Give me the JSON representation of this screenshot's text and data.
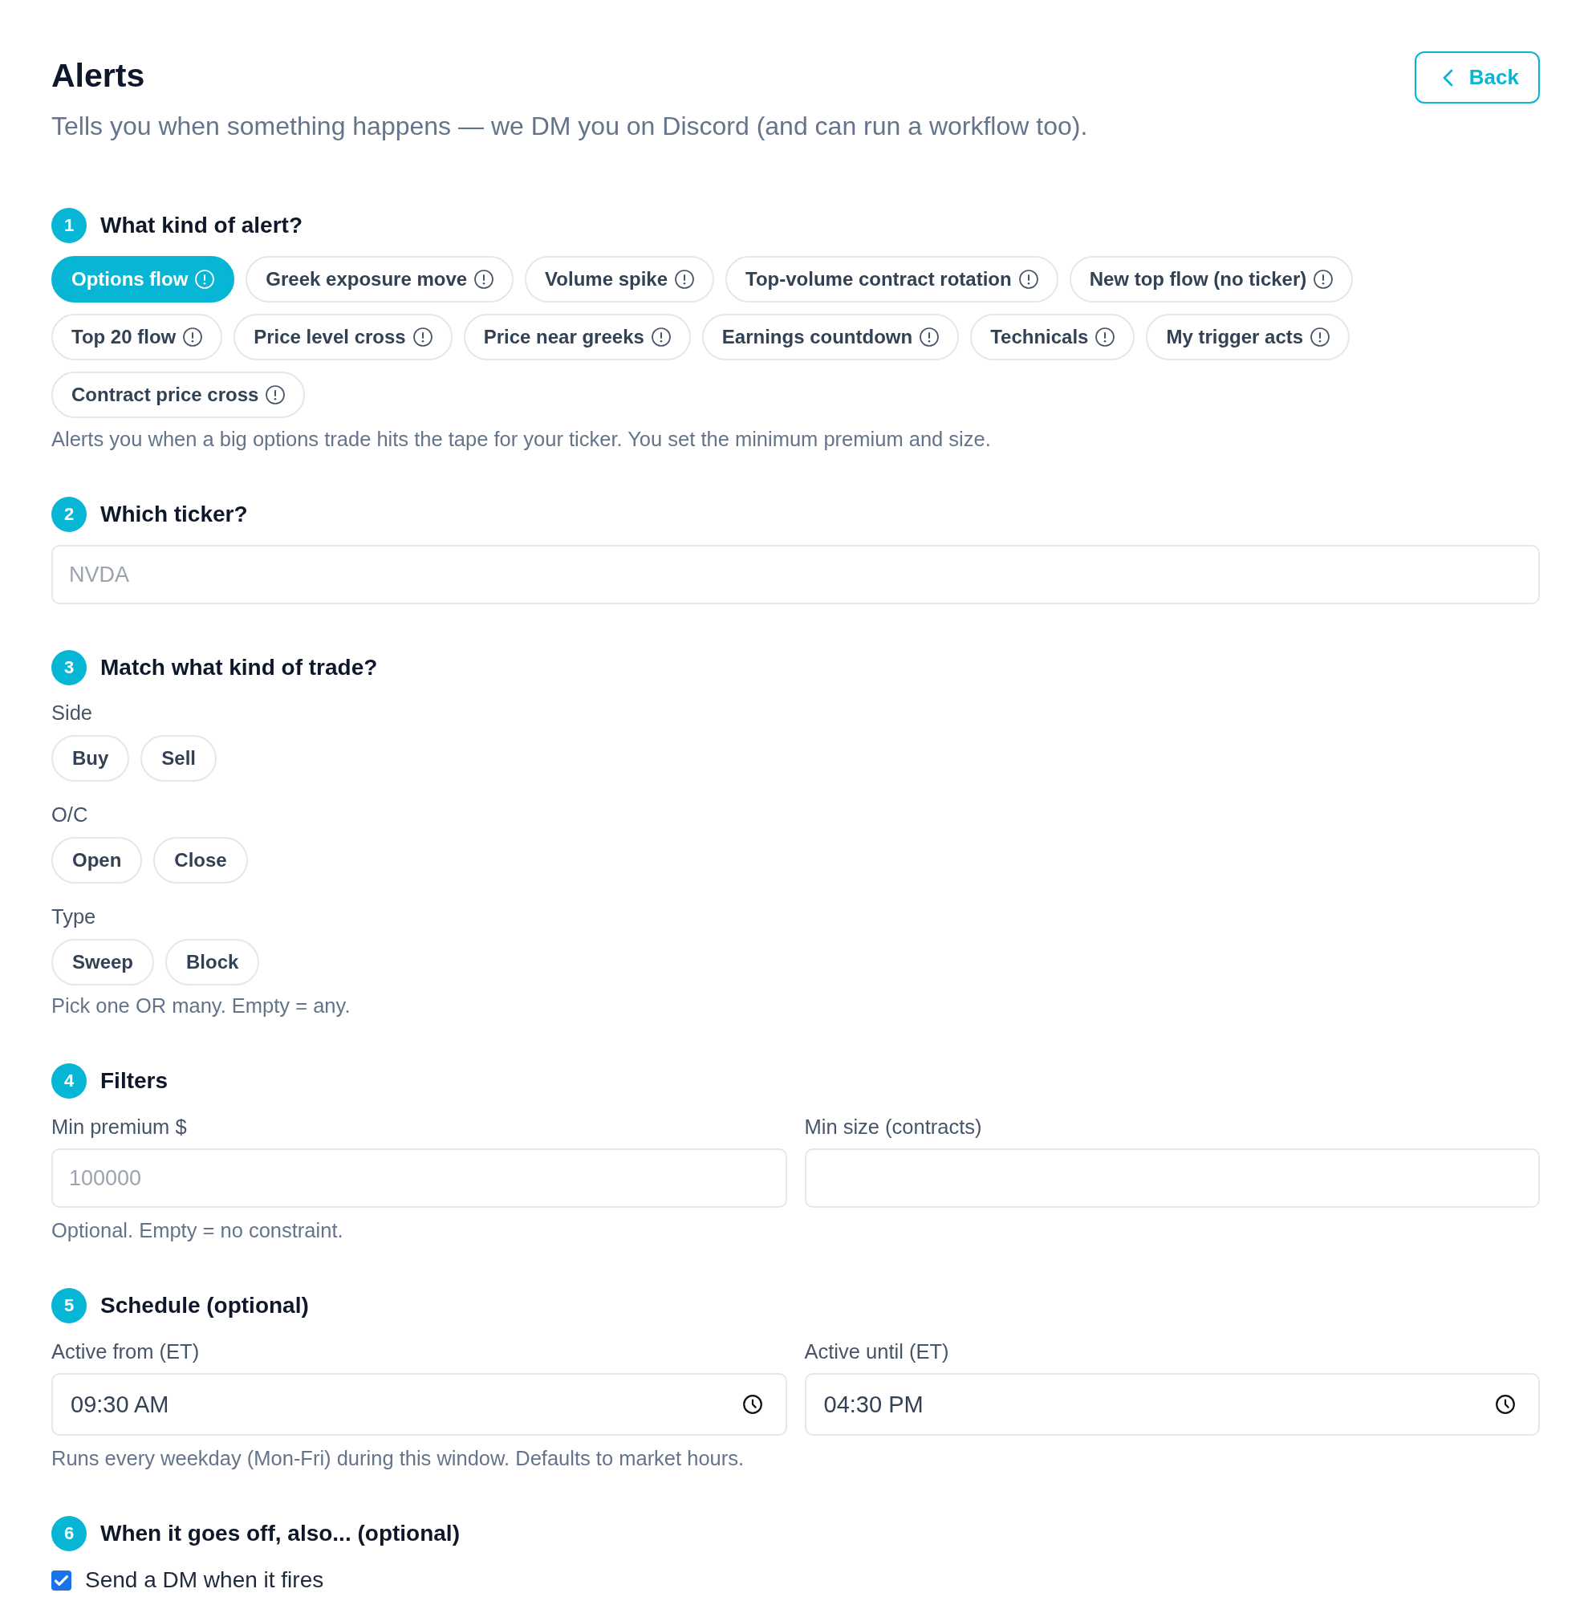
{
  "header": {
    "title": "Alerts",
    "subtitle": "Tells you when something happens — we DM you on Discord (and can run a workflow too).",
    "back_button": {
      "label": "Back"
    }
  },
  "sections": [
    {
      "kind": "chips",
      "number": "1",
      "title": "What kind of alert?",
      "options": [
        {
          "label": "Options flow",
          "selected": true
        },
        {
          "label": "Greek exposure move",
          "selected": false
        },
        {
          "label": "Volume spike",
          "selected": false
        },
        {
          "label": "Top-volume contract rotation",
          "selected": false
        },
        {
          "label": "New top flow (no ticker)",
          "selected": false
        },
        {
          "label": "Top 20 flow",
          "selected": false
        },
        {
          "label": "Price level cross",
          "selected": false
        },
        {
          "label": "Price near greeks",
          "selected": false
        },
        {
          "label": "Earnings countdown",
          "selected": false
        },
        {
          "label": "Technicals",
          "selected": false
        },
        {
          "label": "My trigger acts",
          "selected": false
        },
        {
          "label": "Contract price cross",
          "selected": false
        }
      ],
      "description": "Alerts you when a big options trade hits the tape for your ticker. You set the minimum premium and size."
    },
    {
      "kind": "text_field",
      "number": "2",
      "title": "Which ticker?",
      "field": {
        "placeholder": "NVDA"
      }
    },
    {
      "kind": "toggle_groups",
      "number": "3",
      "title": "Match what kind of trade?",
      "groups": [
        {
          "label": "Side",
          "options": [
            {
              "label": "Buy",
              "selected": false
            },
            {
              "label": "Sell",
              "selected": false
            }
          ]
        },
        {
          "label": "O/C",
          "options": [
            {
              "label": "Open",
              "selected": false
            },
            {
              "label": "Close",
              "selected": false
            }
          ]
        },
        {
          "label": "Type",
          "options": [
            {
              "label": "Sweep",
              "selected": false
            },
            {
              "label": "Block",
              "selected": false
            }
          ]
        }
      ],
      "hint": "Pick one OR many. Empty = any."
    },
    {
      "kind": "field_pair",
      "number": "4",
      "title": "Filters",
      "fields": [
        {
          "kind": "text",
          "label": "Min premium $",
          "placeholder": "100000"
        },
        {
          "kind": "text",
          "label": "Min size (contracts)"
        }
      ],
      "hint": "Optional. Empty = no constraint."
    },
    {
      "kind": "field_pair",
      "number": "5",
      "title": "Schedule (optional)",
      "fields": [
        {
          "kind": "time",
          "label": "Active from (ET)",
          "value": "09:30 AM"
        },
        {
          "kind": "time",
          "label": "Active until (ET)",
          "value": "04:30 PM"
        }
      ],
      "hint": "Runs every weekday (Mon-Fri) during this window. Defaults to market hours."
    },
    {
      "kind": "checkboxes",
      "number": "6",
      "title": "When it goes off, also... (optional)",
      "options": [
        {
          "label": "Send a DM when it fires",
          "checked": true
        }
      ]
    }
  ]
}
